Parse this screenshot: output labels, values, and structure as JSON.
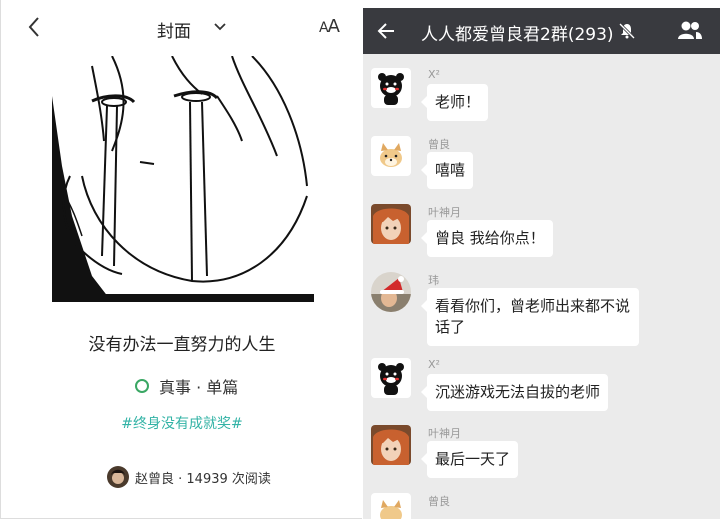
{
  "left": {
    "cover_title": "封面",
    "font_size_label_big": "A",
    "font_size_label_small": "A",
    "story_title": "没有办法一直努力的人生",
    "category": "真事 · 单篇",
    "hashtag": "#终身没有成就奖#",
    "author_line": "赵曾良 · 14939 次阅读",
    "accent_green": "#3aa764",
    "accent_teal": "#33b3a6"
  },
  "chat": {
    "title": "人人都爱曾良君2群(293)",
    "header_bg": "#393a3f",
    "messages": [
      {
        "sender": "X²",
        "text": "老师！",
        "avatar": "bear-avatar"
      },
      {
        "sender": "曾良",
        "text": "嘻嘻",
        "avatar": "dog-avatar"
      },
      {
        "sender": "叶神月",
        "text": "曾良 我给你点！",
        "avatar": "redhair-avatar"
      },
      {
        "sender": "玮",
        "text": "看看你们，曾老师出来都不说话了",
        "avatar": "santa-avatar"
      },
      {
        "sender": "X²",
        "text": "沉迷游戏无法自拔的老师",
        "avatar": "bear-avatar"
      },
      {
        "sender": "叶神月",
        "text": "最后一天了",
        "avatar": "redhair-avatar"
      },
      {
        "sender": "曾良",
        "text": "",
        "avatar": "dog-avatar"
      }
    ]
  }
}
